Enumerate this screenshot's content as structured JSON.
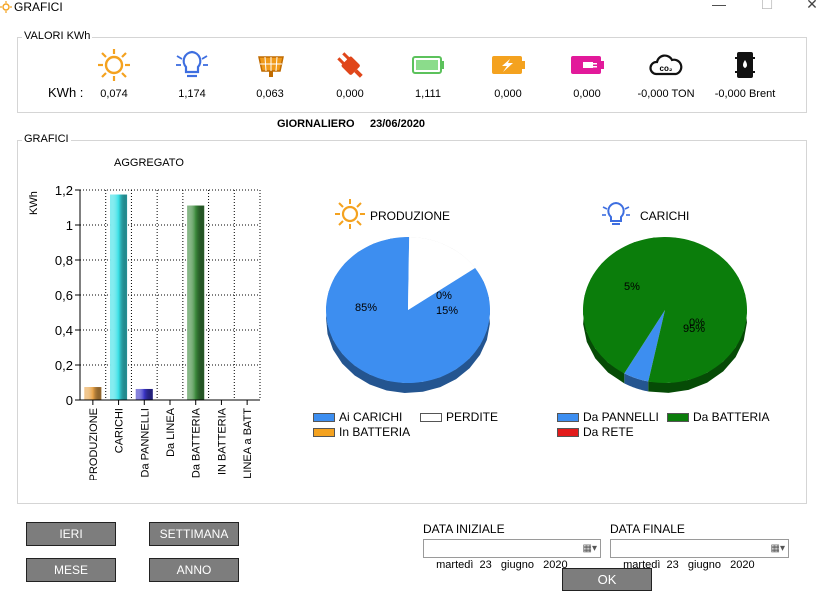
{
  "window": {
    "title": "GRAFICI",
    "minimize": "—",
    "maximize": "☐",
    "close": "✕"
  },
  "kwh_group": {
    "legend": "VALORI KWh",
    "row_label": "KWh :",
    "items": [
      {
        "icon": "sun-icon",
        "value": "0,074"
      },
      {
        "icon": "lightbulb-icon",
        "value": "1,174"
      },
      {
        "icon": "solar-panel-icon",
        "value": "0,063"
      },
      {
        "icon": "power-plug-icon",
        "value": "0,000"
      },
      {
        "icon": "battery-full-icon",
        "value": "1,111"
      },
      {
        "icon": "battery-charge-icon",
        "value": "0,000"
      },
      {
        "icon": "battery-discharge-icon",
        "value": "0,000"
      },
      {
        "icon": "co2-cloud-icon",
        "value": "-0,000 TON"
      },
      {
        "icon": "oil-barrel-icon",
        "value": "-0,000 Brent"
      }
    ]
  },
  "period": {
    "label": "GIORNALIERO",
    "date": "23/06/2020"
  },
  "charts_group": {
    "legend": "GRAFICI"
  },
  "bar_chart": {
    "title": "AGGREGATO",
    "ylabel": "KWh"
  },
  "pie_production": {
    "title": "PRODUZIONE",
    "legend": [
      {
        "label": "Ai CARICHI",
        "color": "#3d8ef0"
      },
      {
        "label": "PERDITE",
        "color": "#ffffff"
      },
      {
        "label": "In BATTERIA",
        "color": "#f4a21f"
      }
    ]
  },
  "pie_loads": {
    "title": "CARICHI",
    "legend": [
      {
        "label": "Da PANNELLI",
        "color": "#3d8ef0"
      },
      {
        "label": "Da BATTERIA",
        "color": "#0b7d0b"
      },
      {
        "label": "Da RETE",
        "color": "#e21b1b"
      }
    ]
  },
  "chart_data": [
    {
      "type": "bar",
      "title": "AGGREGATO",
      "ylabel": "KWh",
      "ylim": [
        0,
        1.2
      ],
      "yticks": [
        "0",
        "0,2",
        "0,4",
        "0,6",
        "0,8",
        "1",
        "1,2"
      ],
      "categories": [
        "PRODUZIONE",
        "CARICHI",
        "Da PANNELLI",
        "Da LINEA",
        "Da BATTERIA",
        "IN BATTERIA",
        "LINEA a BATT"
      ],
      "values": [
        0.074,
        1.174,
        0.063,
        0,
        1.111,
        0,
        0
      ],
      "colors": [
        "#e8a44a",
        "#39e0e6",
        "#3b35c7",
        "#888888",
        "#3c8a3c",
        "#888888",
        "#888888"
      ],
      "grid": true
    },
    {
      "type": "pie",
      "title": "PRODUZIONE",
      "slices": [
        {
          "label": "Ai CARICHI",
          "value": 85,
          "text": "85%",
          "color": "#3d8ef0"
        },
        {
          "label": "PERDITE",
          "value": 15,
          "text": "15%",
          "color": "#ffffff"
        },
        {
          "label": "In BATTERIA",
          "value": 0,
          "text": "0%",
          "color": "#f4a21f"
        }
      ]
    },
    {
      "type": "pie",
      "title": "CARICHI",
      "slices": [
        {
          "label": "Da PANNELLI",
          "value": 5,
          "text": "5%",
          "color": "#3d8ef0"
        },
        {
          "label": "Da BATTERIA",
          "value": 95,
          "text": "95%",
          "color": "#0b7d0b"
        },
        {
          "label": "Da RETE",
          "value": 0,
          "text": "0%",
          "color": "#e21b1b"
        }
      ]
    }
  ],
  "buttons": {
    "ieri": "IERI",
    "settimana": "SETTIMANA",
    "mese": "MESE",
    "anno": "ANNO",
    "ok": "OK"
  },
  "dates": {
    "start_label": "DATA INIZIALE",
    "start_value": "martedì  23   giugno   2020",
    "end_label": "DATA FINALE",
    "end_value": "martedì  23   giugno   2020"
  }
}
